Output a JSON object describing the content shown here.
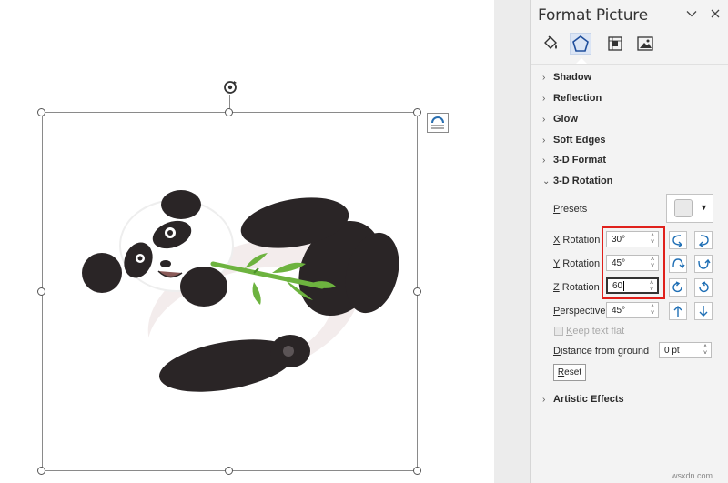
{
  "pane": {
    "title": "Format Picture",
    "tabs": [
      {
        "name": "fill-line",
        "icon": "paint-bucket-icon"
      },
      {
        "name": "effects",
        "icon": "pentagon-icon",
        "active": true
      },
      {
        "name": "layout-properties",
        "icon": "size-properties-icon"
      },
      {
        "name": "picture",
        "icon": "picture-icon"
      }
    ],
    "sections": {
      "shadow": "Shadow",
      "reflection": "Reflection",
      "glow": "Glow",
      "soft_edges": "Soft Edges",
      "format_3d": "3-D Format",
      "rotation_3d": "3-D Rotation",
      "artistic_effects": "Artistic Effects"
    },
    "rotation": {
      "presets_label_first": "P",
      "presets_label_rest": "resets",
      "x_label_first": "X",
      "x_label_rest": " Rotation",
      "x_value": "30°",
      "y_label_first": "Y",
      "y_label_rest": " Rotation",
      "y_value": "45°",
      "z_label_first": "Z",
      "z_label_rest": " Rotation",
      "z_value": "60",
      "perspective_label_first": "P",
      "perspective_label_rest": "erspective",
      "perspective_value": "45°",
      "keep_text_flat_first": "K",
      "keep_text_flat_rest": "eep text flat",
      "distance_label_first": "D",
      "distance_label_rest": "istance from ground",
      "distance_value": "0 pt",
      "reset_label_first": "R",
      "reset_label_rest": "eset"
    }
  },
  "watermark": "wsxdn.com",
  "colors": {
    "highlight": "#e0201b",
    "rotation_icon": "#1f6fb5",
    "panda_black": "#2a2526",
    "bamboo": "#6db33f"
  }
}
